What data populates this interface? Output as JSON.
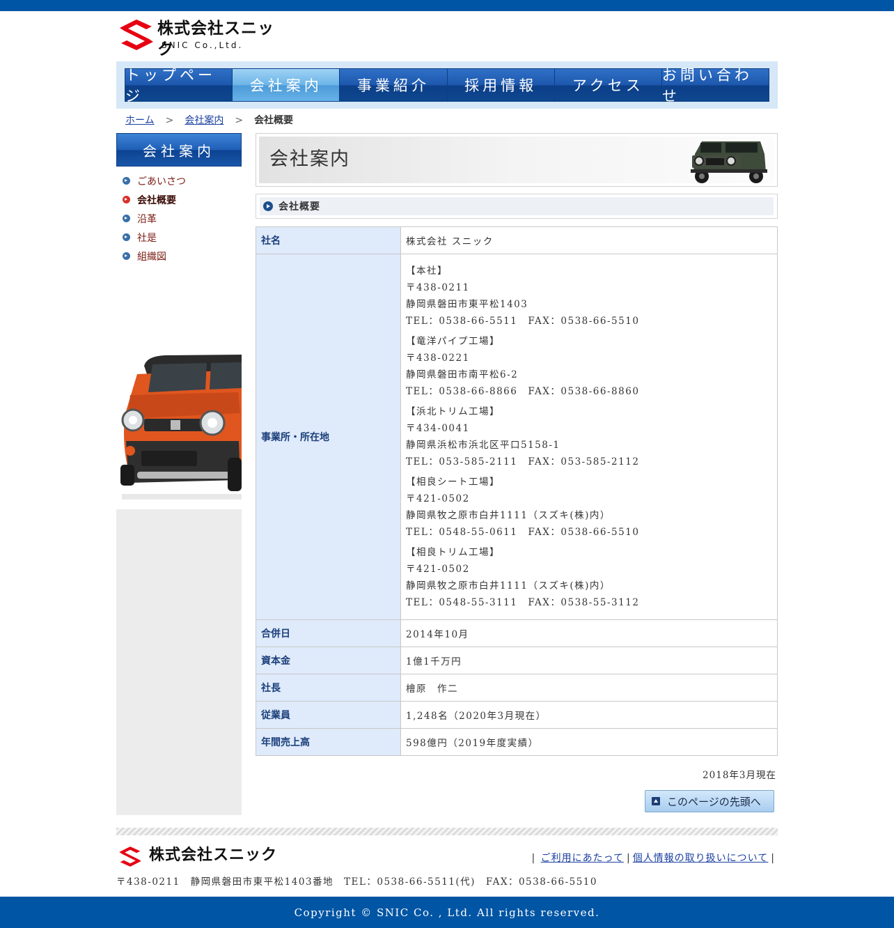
{
  "company": {
    "name_jp": "株式会社スニック",
    "name_en": "SNIC   Co.,Ltd."
  },
  "nav": {
    "items": [
      "トップページ",
      "会社案内",
      "事業紹介",
      "採用情報",
      "アクセス",
      "お問い合わせ"
    ],
    "active": "会社案内"
  },
  "breadcrumb": {
    "home": "ホーム",
    "section": "会社案内",
    "current": "会社概要",
    "sep": ">"
  },
  "sidebar": {
    "title": "会社案内",
    "items": [
      "ごあいさつ",
      "会社概要",
      "沿革",
      "社是",
      "組織図"
    ],
    "active": "会社概要"
  },
  "page": {
    "title": "会社案内",
    "section": "会社概要"
  },
  "table": {
    "company_name": {
      "label": "社名",
      "value": "株式会社 スニック"
    },
    "locations": {
      "label": "事業所・所在地",
      "offices": [
        {
          "name": "【本社】",
          "zip": "〒438-0211",
          "address": "静岡県磐田市東平松1403",
          "contact": "TEL：0538-66-5511　FAX：0538-66-5510"
        },
        {
          "name": "【竜洋パイプ工場】",
          "zip": "〒438-0221",
          "address": "静岡県磐田市南平松6-2",
          "contact": "TEL：0538-66-8866　FAX：0538-66-8860"
        },
        {
          "name": "【浜北トリム工場】",
          "zip": "〒434-0041",
          "address": "静岡県浜松市浜北区平口5158-1",
          "contact": "TEL：053-585-2111　FAX：053-585-2112"
        },
        {
          "name": "【相良シート工場】",
          "zip": "〒421-0502",
          "address": "静岡県牧之原市白井1111（スズキ(株)内）",
          "contact": "TEL：0548-55-0611　FAX：0538-66-5510"
        },
        {
          "name": "【相良トリム工場】",
          "zip": "〒421-0502",
          "address": "静岡県牧之原市白井1111（スズキ(株)内）",
          "contact": "TEL：0548-55-3111　FAX：0538-55-3112"
        }
      ]
    },
    "merger": {
      "label": "合併日",
      "value": "2014年10月"
    },
    "capital": {
      "label": "資本金",
      "value": "1億1千万円"
    },
    "president": {
      "label": "社長",
      "value": "檜原　作二"
    },
    "employees": {
      "label": "従業員",
      "value": "1,248名（2020年3月現在）"
    },
    "sales": {
      "label": "年間売上高",
      "value": "598億円（2019年度実績）"
    }
  },
  "as_of": "2018年3月現在",
  "page_top": "このページの先頭へ",
  "footer": {
    "links": [
      "ご利用にあたって",
      "個人情報の取り扱いについて"
    ],
    "address": "〒438-0211　静岡県磐田市東平松1403番地　TEL：0538-66-5511(代)　FAX：0538-66-5510",
    "copyright": "Copyright © SNIC Co. , Ltd. All rights reserved."
  },
  "colors": {
    "brand_blue": "#0055a4",
    "logo_red": "#e60012",
    "header_cell": "#dfeafb",
    "nav_active": "#6cb4e8"
  },
  "icons": {
    "sidebar_bullet": "arrow-circle-icon",
    "section_bullet": "arrow-circle-icon",
    "page_top": "arrow-up-icon"
  }
}
